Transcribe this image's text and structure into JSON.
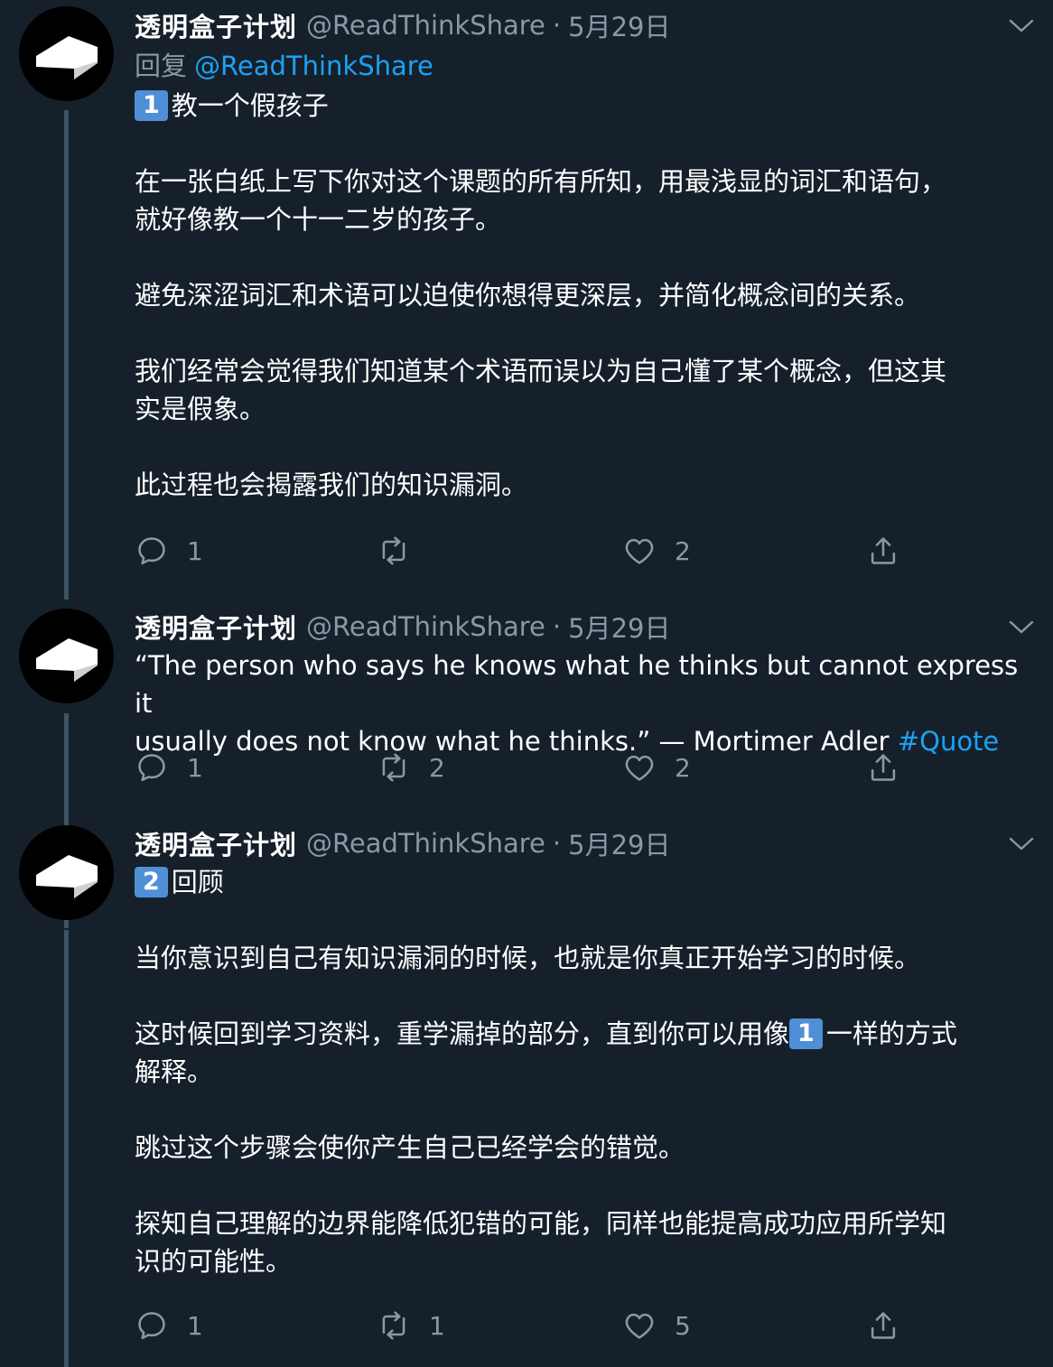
{
  "colors": {
    "background": "#15202b",
    "text": "#ffffff",
    "muted": "#8899a6",
    "link": "#1da1f2",
    "thread_line": "#3d5466",
    "keycap": "#4f8fd6"
  },
  "tweets": [
    {
      "name": "透明盒子计划",
      "handle": "@ReadThinkShare",
      "separator": "·",
      "date": "5月29日",
      "reply_label": "回复",
      "reply_mention": "@ReadThinkShare",
      "heading_key": "1",
      "heading": "教一个假孩子",
      "paragraphs": [
        "在一张白纸上写下你对这个课题的所有所知，用最浅显的词汇和语句，\n就好像教一个十一二岁的孩子。",
        "避免深涩词汇和术语可以迫使你想得更深层，并简化概念间的关系。",
        "我们经常会觉得我们知道某个术语而误以为自己懂了某个概念，但这其\n实是假象。",
        "此过程也会揭露我们的知识漏洞。"
      ],
      "stats": {
        "replies": "1",
        "retweets": "",
        "likes": "2"
      },
      "icons": {
        "reply": "comment-icon",
        "retweet": "retweet-icon",
        "like": "heart-icon",
        "share": "share-icon"
      }
    },
    {
      "name": "透明盒子计划",
      "handle": "@ReadThinkShare",
      "separator": "·",
      "date": "5月29日",
      "text": "“The person who says he knows what he thinks but cannot express it\nusually does not know what he thinks.” — Mortimer Adler ",
      "hashtag": "#Quote",
      "stats": {
        "replies": "1",
        "retweets": "2",
        "likes": "2"
      }
    },
    {
      "name": "透明盒子计划",
      "handle": "@ReadThinkShare",
      "separator": "·",
      "date": "5月29日",
      "heading_key": "2",
      "heading": "回顾",
      "paragraphs": [
        "当你意识到自己有知识漏洞的时候，也就是你真正开始学习的时候。",
        "这时候回到学习资料，重学漏掉的部分，直到你可以用像",
        "跳过这个步骤会使你产生自己已经学会的错觉。",
        "探知自己理解的边界能降低犯错的可能，同样也能提高成功应用所学知\n识的可能性。"
      ],
      "inline_key": "1",
      "paragraph_2_tail": "一样的方式\n解释。",
      "stats": {
        "replies": "1",
        "retweets": "1",
        "likes": "5"
      }
    }
  ]
}
